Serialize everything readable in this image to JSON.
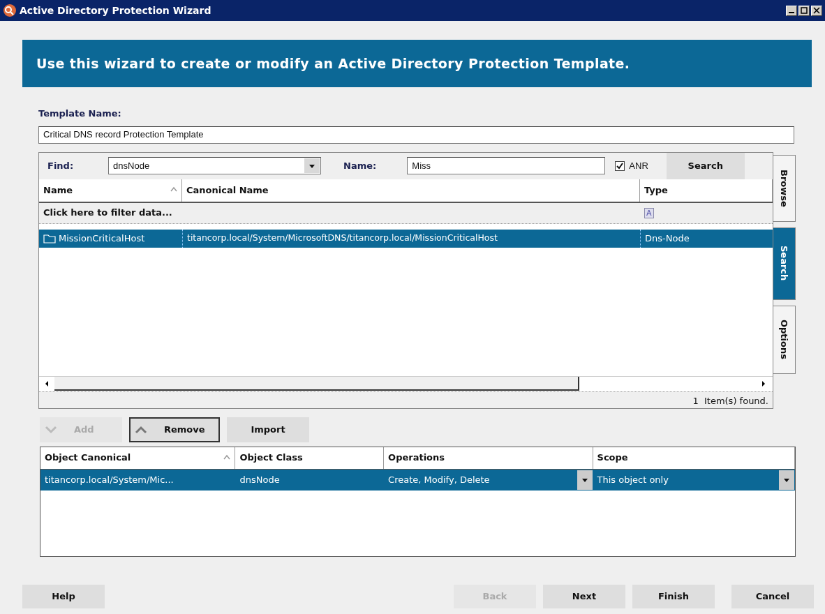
{
  "window": {
    "title": "Active Directory Protection Wizard"
  },
  "banner": "Use this wizard to create or modify an Active Directory Protection Template.",
  "template_name": {
    "label": "Template Name:",
    "value": "Critical DNS record Protection Template"
  },
  "find": {
    "label": "Find:",
    "value": "dnsNode"
  },
  "name_filter": {
    "label": "Name:",
    "value": "Miss"
  },
  "anr": {
    "label": "ANR",
    "checked": true
  },
  "search_button": "Search",
  "results": {
    "columns": [
      {
        "label": "Name",
        "sorted": true
      },
      {
        "label": "Canonical Name",
        "sorted": false
      },
      {
        "label": "Type",
        "sorted": false
      }
    ],
    "filter_row": "Click here to filter data...",
    "type_filter_icon": "A",
    "rows": [
      {
        "name": "MissionCriticalHost",
        "canonical": "titancorp.local/System/MicrosoftDNS/titancorp.local/MissionCriticalHost",
        "type": "Dns-Node",
        "selected": true
      }
    ],
    "status": "1  Item(s) found."
  },
  "side_tabs": [
    {
      "label": "Browse",
      "selected": false
    },
    {
      "label": "Search",
      "selected": true
    },
    {
      "label": "Options",
      "selected": false
    }
  ],
  "actions": [
    {
      "label": "Add",
      "kind": "down",
      "disabled": true,
      "focused": false
    },
    {
      "label": "Remove",
      "kind": "up",
      "disabled": false,
      "focused": true
    },
    {
      "label": "Import",
      "kind": "plain",
      "disabled": false,
      "focused": false
    }
  ],
  "objects": {
    "columns": [
      {
        "label": "Object Canonical",
        "sorted": true
      },
      {
        "label": "Object Class",
        "sorted": false
      },
      {
        "label": "Operations",
        "sorted": false
      },
      {
        "label": "Scope",
        "sorted": false
      }
    ],
    "rows": [
      {
        "canonical": "titancorp.local/System/Mic...",
        "class": "dnsNode",
        "operations": "Create, Modify, Delete",
        "scope": "This object only",
        "selected": true
      }
    ]
  },
  "footer": [
    {
      "label": "Help",
      "disabled": false
    },
    {
      "label": "Back",
      "disabled": true
    },
    {
      "label": "Next",
      "disabled": false
    },
    {
      "label": "Finish",
      "disabled": false
    },
    {
      "label": "Cancel",
      "disabled": false
    }
  ]
}
